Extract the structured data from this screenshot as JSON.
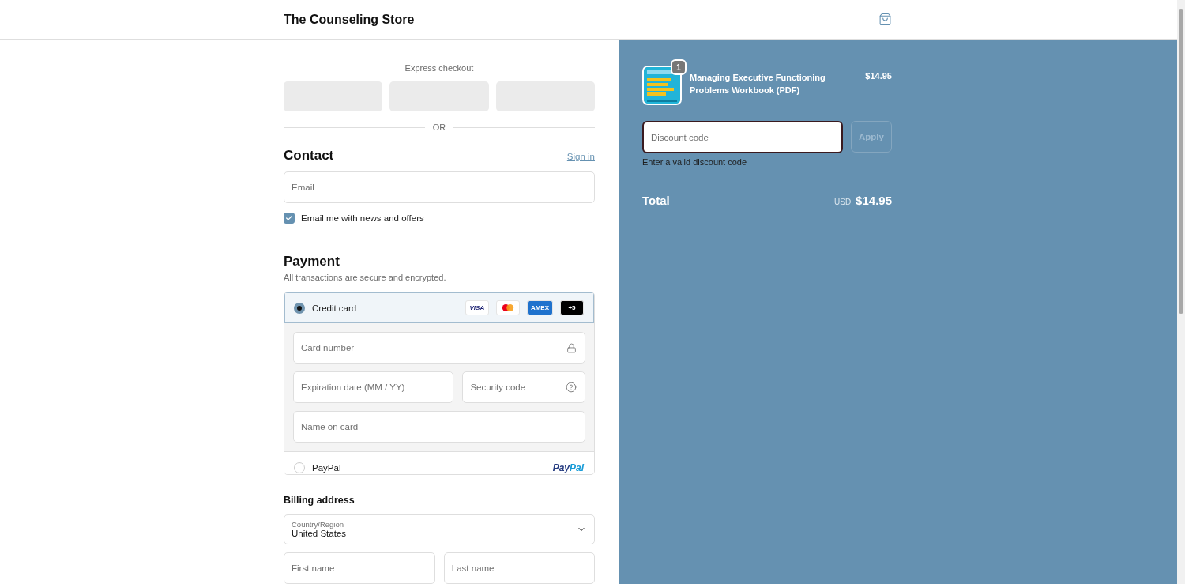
{
  "header": {
    "store_name": "The Counseling Store"
  },
  "express_checkout": {
    "label": "Express checkout",
    "divider": "OR"
  },
  "contact": {
    "title": "Contact",
    "sign_in": "Sign in",
    "email": {
      "placeholder": "Email"
    },
    "newsletter": {
      "label": "Email me with news and offers",
      "checked": true
    }
  },
  "payment": {
    "title": "Payment",
    "subtitle": "All transactions are secure and encrypted.",
    "methods": [
      {
        "kind": "card",
        "label": "Credit card",
        "selected": true,
        "badges": [
          "VISA",
          "AMEX",
          "+5"
        ]
      },
      {
        "kind": "paypal",
        "label": "PayPal",
        "selected": false,
        "brand": [
          "Pay",
          "Pal"
        ]
      }
    ],
    "card_fields": {
      "number": "Card number",
      "expiry": "Expiration date (MM / YY)",
      "security": "Security code",
      "name": "Name on card"
    }
  },
  "billing": {
    "title": "Billing address",
    "country": {
      "label": "Country/Region",
      "value": "United States"
    },
    "first_name": {
      "placeholder": "First name"
    },
    "last_name": {
      "placeholder": "Last name"
    }
  },
  "summary": {
    "items": [
      {
        "title": "Managing Executive Functioning Problems Workbook (PDF)",
        "quantity": "1",
        "price": "$14.95"
      }
    ],
    "discount": {
      "placeholder": "Discount code",
      "button": "Apply",
      "error": "Enter a valid discount code"
    },
    "total": {
      "label": "Total",
      "currency": "USD",
      "amount": "$14.95"
    }
  }
}
